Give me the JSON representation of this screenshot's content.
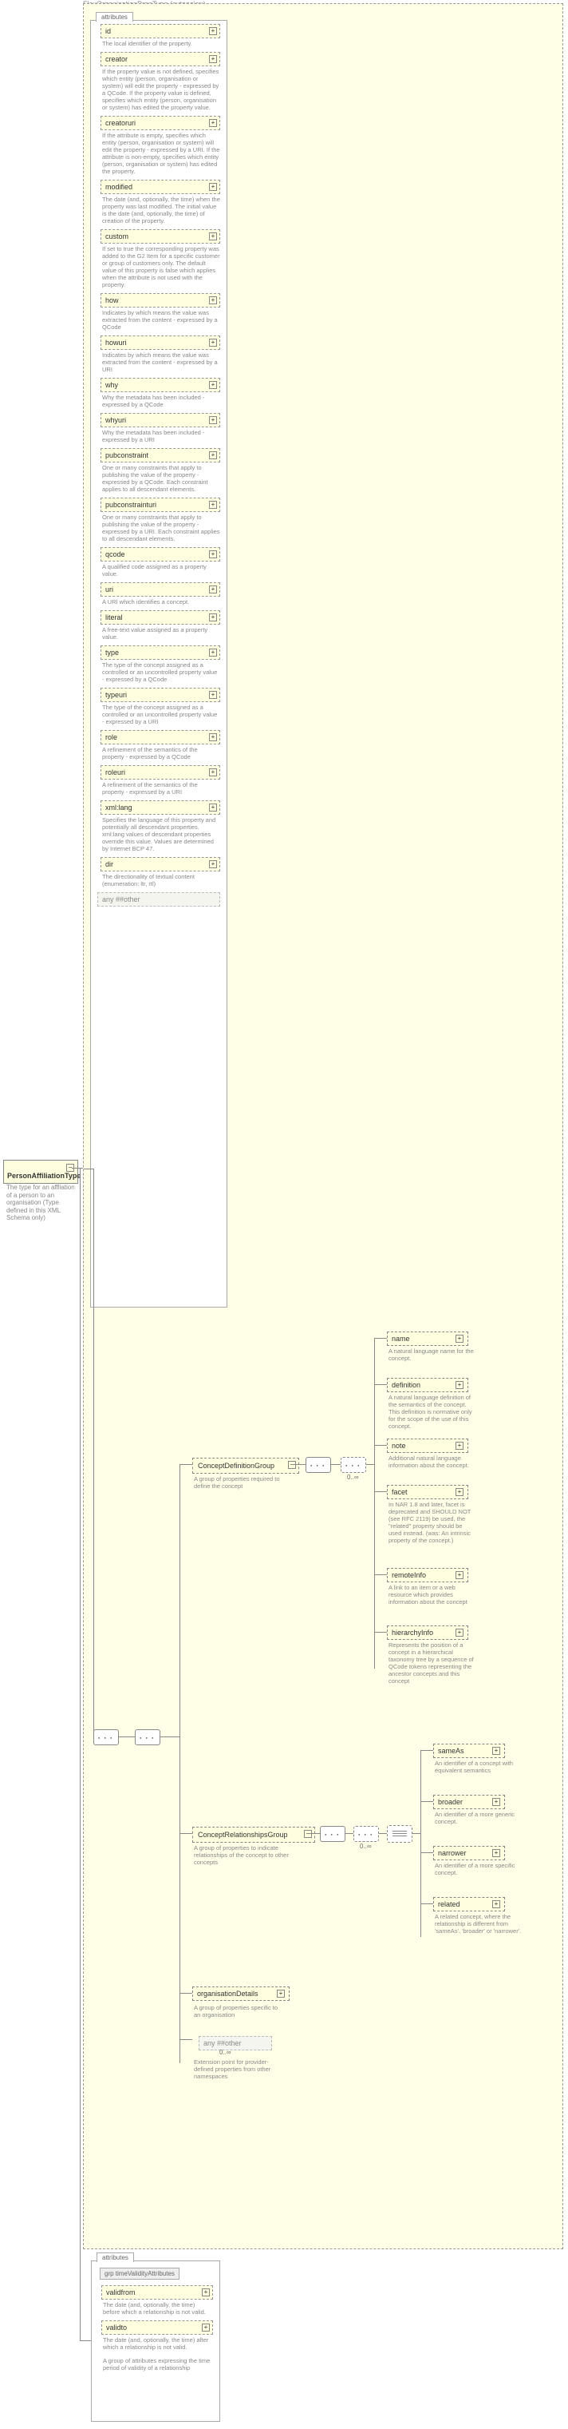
{
  "root": {
    "name": "PersonAffiliationType",
    "doc": "The type for an affliation of a person to an organisation (Type defined in this XML Schema only)"
  },
  "extension": {
    "title": "FlexOrganisationPropType (extension)"
  },
  "attributes_label": "attributes",
  "attrs": [
    {
      "name": "id",
      "doc": "The local identifier of the property."
    },
    {
      "name": "creator",
      "doc": "If the property value is not defined, specifies which entity (person, organisation or system) will edit the property - expressed by a QCode. If the property value is defined, specifies which entity (person, organisation or system) has edited the property value."
    },
    {
      "name": "creatoruri",
      "doc": "If the attribute is empty, specifies which entity (person, organisation or system) will edit the property - expressed by a URI. If the attribute is non-empty, specifies which entity (person, organisation or system) has edited the property."
    },
    {
      "name": "modified",
      "doc": "The date (and, optionally, the time) when the property was last modified. The initial value is the date (and, optionally, the time) of creation of the property."
    },
    {
      "name": "custom",
      "doc": "If set to true the corresponding property was added to the G2 Item for a specific customer or group of customers only. The default value of this property is false which applies when the attribute is not used with the property."
    },
    {
      "name": "how",
      "doc": "Indicates by which means the value was extracted from the content - expressed by a QCode"
    },
    {
      "name": "howuri",
      "doc": "Indicates by which means the value was extracted from the content - expressed by a URI"
    },
    {
      "name": "why",
      "doc": "Why the metadata has been included - expressed by a QCode"
    },
    {
      "name": "whyuri",
      "doc": "Why the metadata has been included - expressed by a URI"
    },
    {
      "name": "pubconstraint",
      "doc": "One or many constraints that apply to publishing the value of the property - expressed by a QCode. Each constraint applies to all descendant elements."
    },
    {
      "name": "pubconstrainturi",
      "doc": "One or many constraints that apply to publishing the value of the property - expressed by a URI. Each constraint applies to all descendant elements."
    },
    {
      "name": "qcode",
      "doc": "A qualified code assigned as a property value."
    },
    {
      "name": "uri",
      "doc": "A URI which identifies a concept."
    },
    {
      "name": "literal",
      "doc": "A free-text value assigned as a property value."
    },
    {
      "name": "type",
      "doc": "The type of the concept assigned as a controlled or an uncontrolled property value - expressed by a QCode"
    },
    {
      "name": "typeuri",
      "doc": "The type of the concept assigned as a controlled or an uncontrolled property value - expressed by a URI"
    },
    {
      "name": "role",
      "doc": "A refinement of the semantics of the property - expressed by a QCode"
    },
    {
      "name": "roleuri",
      "doc": "A refinement of the semantics of the property - expressed by a URI"
    },
    {
      "name": "xml:lang",
      "doc": "Specifies the language of this property and potentially all descendant properties. xml:lang values of descendant properties override this value. Values are determined by Internet BCP 47."
    },
    {
      "name": "dir",
      "doc": "The directionality of textual content (enumeration: ltr, rtl)"
    }
  ],
  "any_other": "any ##other",
  "groups": {
    "cdg": {
      "name": "ConceptDefinitionGroup",
      "doc": "A group of properties required to define the concept"
    },
    "crg": {
      "name": "ConceptRelationshipsGroup",
      "doc": "A group of properties to indicate relationships of the concept to other concepts"
    },
    "orgd": {
      "name": "organisationDetails",
      "doc": "A group of properties specific to an organisation"
    },
    "anyext": {
      "name": "any ##other",
      "card": "0..∞",
      "doc": "Extension point for provider-defined properties from other namespaces"
    }
  },
  "cdg_children": [
    {
      "name": "name",
      "doc": "A natural language name for the concept."
    },
    {
      "name": "definition",
      "doc": "A natural language definition of the semantics of the concept. This definition is normative only for the scope of the use of this concept."
    },
    {
      "name": "note",
      "doc": "Additional natural language information about the concept."
    },
    {
      "name": "facet",
      "doc": "In NAR 1.8 and later, facet is deprecated and SHOULD NOT (see RFC 2119) be used, the \"related\" property should be used instead.  (was: An intrinsic property of the concept.)"
    },
    {
      "name": "remoteInfo",
      "doc": "A link to an item or a web resource which provides information about the concept"
    },
    {
      "name": "hierarchyInfo",
      "doc": "Represents the position of a concept in a hierarchical taxonomy tree by a sequence of QCode tokens representing the ancestor concepts and this concept"
    }
  ],
  "crg_children": [
    {
      "name": "sameAs",
      "doc": "An identifier of a concept with equivalent semantics"
    },
    {
      "name": "broader",
      "doc": "An identifier of a more generic concept."
    },
    {
      "name": "narrower",
      "doc": "An identifier of a more specific concept."
    },
    {
      "name": "related",
      "doc": "A related concept, where the relationship is different from 'sameAs', 'broader' or 'narrower'."
    }
  ],
  "time_validity": {
    "group_label": "grp timeValidityAttributes",
    "items": [
      {
        "name": "validfrom",
        "doc": "The date (and, optionally, the time) before which a relationship is not valid."
      },
      {
        "name": "validto",
        "doc": "The date (and, optionally, the time) after which a relationship is not valid."
      }
    ],
    "doc": "A group of attributes expressing the time period of validity of a relationship"
  },
  "card_0inf": "0..∞"
}
